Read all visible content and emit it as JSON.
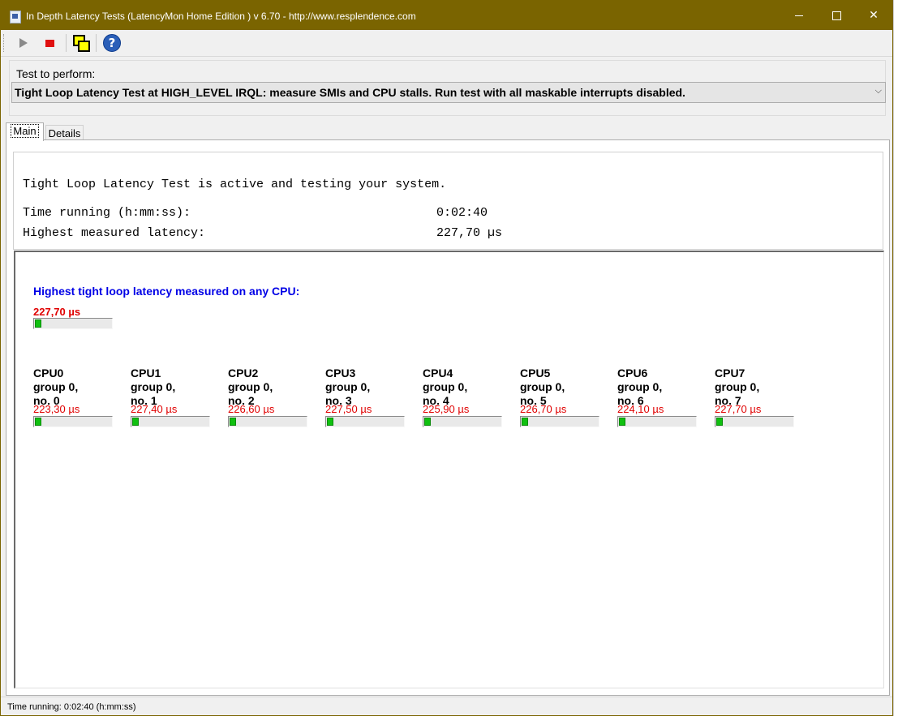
{
  "window": {
    "title": "In Depth Latency Tests  (LatencyMon Home Edition )  v 6.70 - http://www.resplendence.com"
  },
  "toolbar": {
    "buttons": [
      "play-icon",
      "stop-icon",
      "windows-icon",
      "help-icon"
    ]
  },
  "test": {
    "label": "Test to perform:",
    "selected": "Tight Loop Latency Test at HIGH_LEVEL IRQL:  measure SMIs and CPU stalls. Run test with all maskable interrupts disabled."
  },
  "tabs": [
    "Main",
    "Details"
  ],
  "info": {
    "status_line": "Tight Loop Latency Test is active and testing your system.",
    "time_label": "Time running (h:mm:ss):",
    "time_value": "0:02:40",
    "latency_label": "Highest measured latency:",
    "latency_value": "227,70 µs"
  },
  "overall": {
    "title": "Highest tight loop latency measured on any CPU:",
    "value": "227,70 µs",
    "fill_fraction": 0.08
  },
  "cpus": [
    {
      "name": "CPU0",
      "group": "group 0,",
      "no": "no. 0",
      "value": "223,30 µs",
      "fill_fraction": 0.08
    },
    {
      "name": "CPU1",
      "group": "group 0,",
      "no": "no. 1",
      "value": "227,40 µs",
      "fill_fraction": 0.08
    },
    {
      "name": "CPU2",
      "group": "group 0,",
      "no": "no. 2",
      "value": "226,60 µs",
      "fill_fraction": 0.08
    },
    {
      "name": "CPU3",
      "group": "group 0,",
      "no": "no. 3",
      "value": "227,50 µs",
      "fill_fraction": 0.08
    },
    {
      "name": "CPU4",
      "group": "group 0,",
      "no": "no. 4",
      "value": "225,90 µs",
      "fill_fraction": 0.08
    },
    {
      "name": "CPU5",
      "group": "group 0,",
      "no": "no. 5",
      "value": "226,70 µs",
      "fill_fraction": 0.08
    },
    {
      "name": "CPU6",
      "group": "group 0,",
      "no": "no. 6",
      "value": "224,10 µs",
      "fill_fraction": 0.08
    },
    {
      "name": "CPU7",
      "group": "group 0,",
      "no": "no. 7",
      "value": "227,70 µs",
      "fill_fraction": 0.08
    }
  ],
  "statusbar": {
    "text": "Time running: 0:02:40  (h:mm:ss)"
  },
  "colors": {
    "titlebar": "#7a6400",
    "overall_title": "#0000e6",
    "latency_value": "#e00000",
    "bar_fill": "#10c010"
  }
}
